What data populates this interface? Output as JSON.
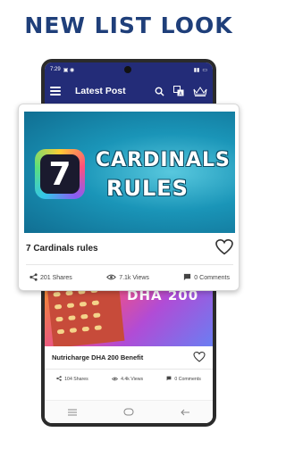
{
  "promo": {
    "headline": "NEW LIST LOOK"
  },
  "statusbar": {
    "time": "7:29"
  },
  "appbar": {
    "title": "Latest Post"
  },
  "overlay_post": {
    "image_badge": "7",
    "image_line1": "CARDINALS",
    "image_line2": "RULES",
    "title": "7 Cardinals rules",
    "shares": "201 Shares",
    "views": "7.1k Views",
    "comments": "0 Comments"
  },
  "second_post": {
    "image_brand": "DHA 200",
    "title": "Nutricharge DHA 200 Benefit",
    "shares": "104 Shares",
    "views": "4.4k Views",
    "comments": "0 Comments"
  },
  "colors": {
    "headline": "#1f3f7a",
    "appbar": "#232c78"
  },
  "icons": [
    "menu-icon",
    "search-icon",
    "translate-icon",
    "crown-icon",
    "heart-icon",
    "share-icon",
    "eye-icon",
    "comment-icon",
    "nav-menu-icon",
    "nav-home-icon",
    "nav-back-icon"
  ]
}
